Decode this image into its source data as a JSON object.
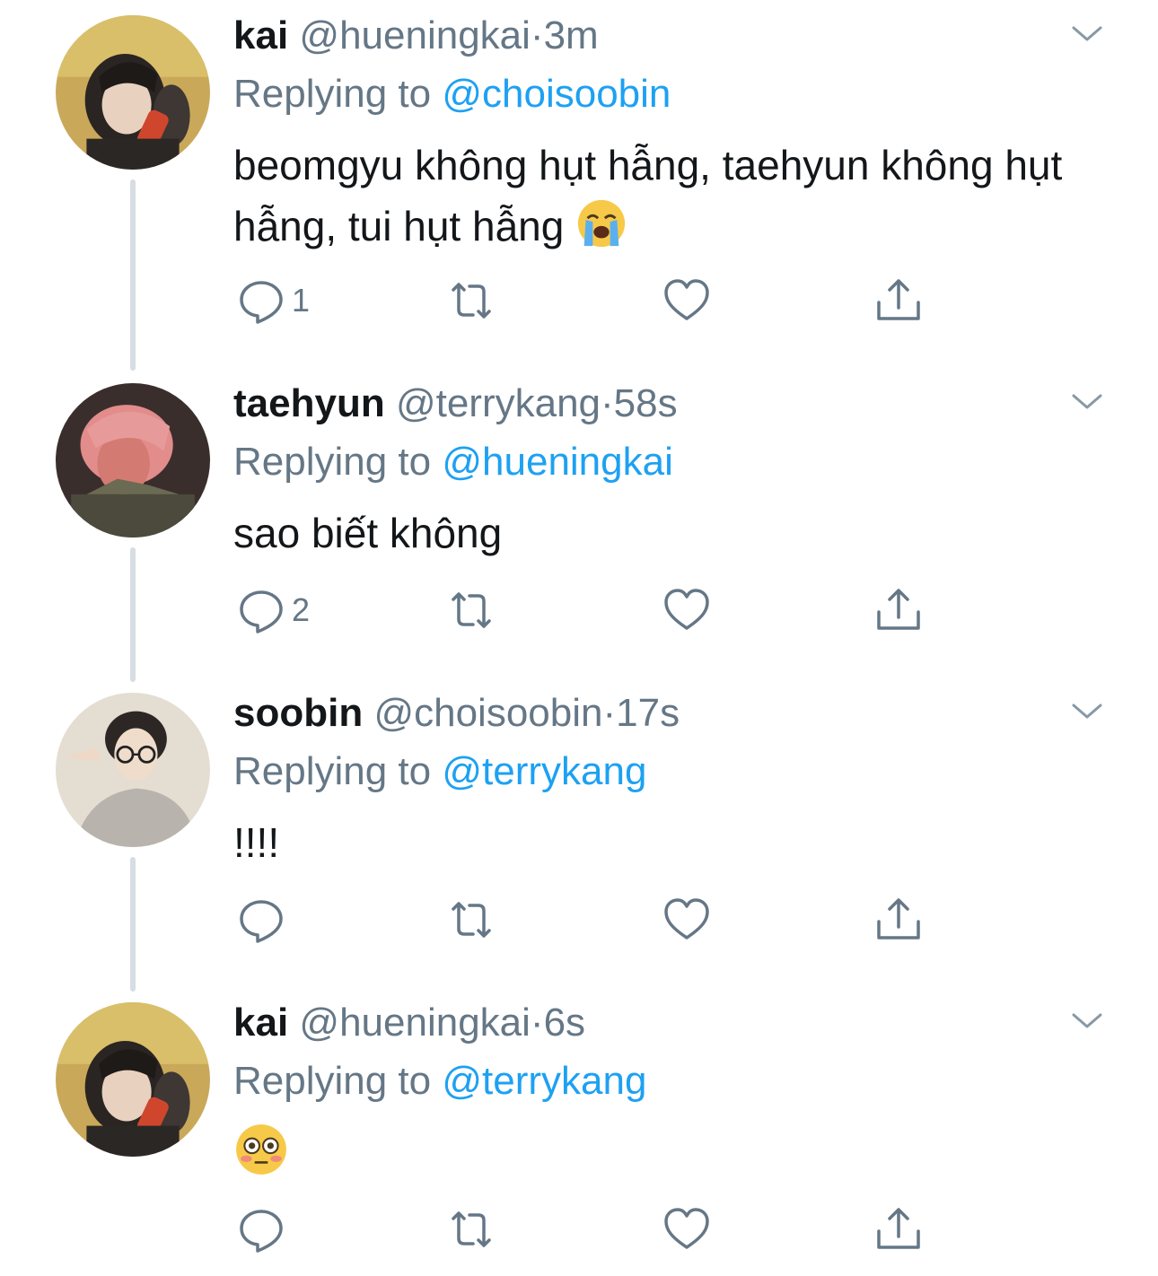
{
  "colors": {
    "text": "#14171a",
    "muted": "#657786",
    "mention": "#1da1f2",
    "thread_line": "#d6dde3"
  },
  "tweets": [
    {
      "name": "kai",
      "handle": "@hueningkai",
      "dot": "·",
      "time": "3m",
      "replying_prefix": "Replying to ",
      "replying_to": "@choisoobin",
      "text_1": "beomgyu không hụt hẫng, taehyun không hụt hẫng, tui hụt hẫng",
      "emoji": "loudly-crying-face",
      "reply_count": "1",
      "avatar": "kai-avatar"
    },
    {
      "name": "taehyun",
      "handle": "@terrykang",
      "dot": "·",
      "time": "58s",
      "replying_prefix": "Replying to ",
      "replying_to": "@hueningkai",
      "text_1": "sao biết không",
      "reply_count": "2",
      "avatar": "taehyun-avatar"
    },
    {
      "name": "soobin",
      "handle": "@choisoobin",
      "dot": "·",
      "time": "17s",
      "replying_prefix": "Replying to ",
      "replying_to": "@terrykang",
      "text_1": "!!!!",
      "reply_count": "",
      "avatar": "soobin-avatar"
    },
    {
      "name": "kai",
      "handle": "@hueningkai",
      "dot": "·",
      "time": "6s",
      "replying_prefix": "Replying to ",
      "replying_to": "@terrykang",
      "text_1": "",
      "emoji": "flushed-face",
      "reply_count": "",
      "avatar": "kai-avatar"
    }
  ],
  "icons": [
    "reply-icon",
    "retweet-icon",
    "like-icon",
    "share-icon",
    "chevron-down-icon"
  ]
}
